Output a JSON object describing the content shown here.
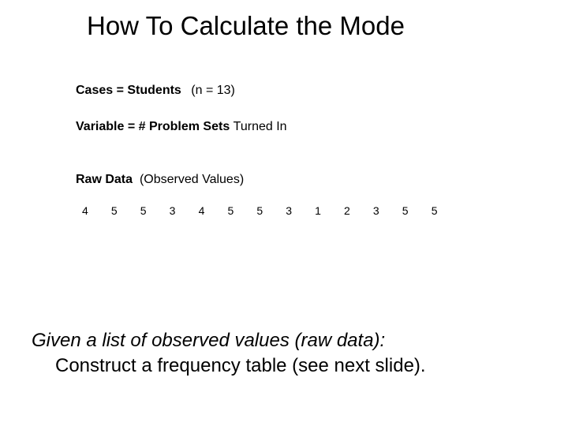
{
  "title": "How To Calculate the Mode",
  "cases": {
    "label": "Cases = Students",
    "n": "(n = 13)"
  },
  "variable": {
    "label": "Variable = # Problem Sets",
    "suffix": "Turned In"
  },
  "rawdata": {
    "label": "Raw Data",
    "suffix": "(Observed Values)",
    "values": [
      "4",
      "5",
      "5",
      "3",
      "4",
      "5",
      "5",
      "3",
      "1",
      "2",
      "3",
      "5",
      "5"
    ]
  },
  "body": {
    "line1": "Given a list of observed values (raw data):",
    "line2": "Construct a frequency table (see next slide)."
  }
}
